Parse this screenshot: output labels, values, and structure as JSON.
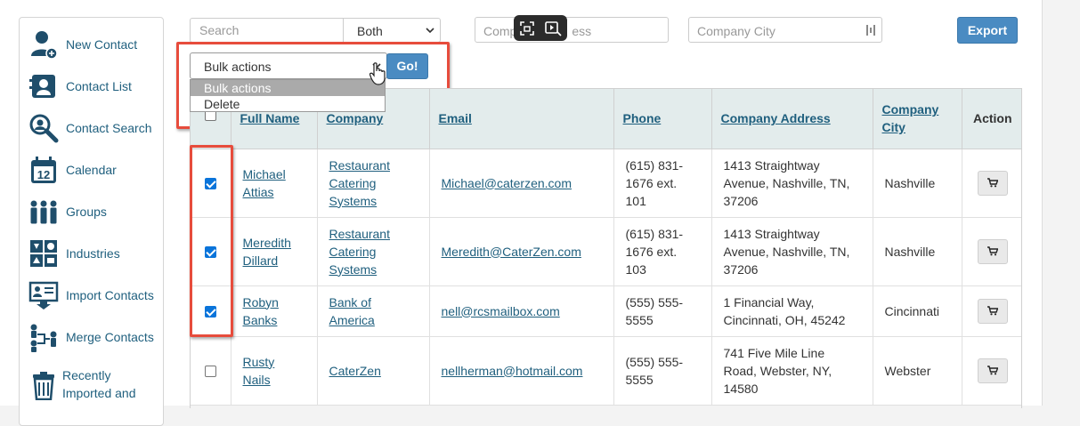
{
  "sidebar": {
    "items": [
      {
        "label": "New Contact",
        "icon": "new-contact-icon"
      },
      {
        "label": "Contact List",
        "icon": "contact-list-icon"
      },
      {
        "label": "Contact Search",
        "icon": "magnifier-icon"
      },
      {
        "label": "Calendar",
        "icon": "calendar-icon"
      },
      {
        "label": "Groups",
        "icon": "groups-icon"
      },
      {
        "label": "Industries",
        "icon": "industries-icon"
      },
      {
        "label": "Import Contacts",
        "icon": "import-contacts-icon"
      },
      {
        "label": "Merge Contacts",
        "icon": "merge-contacts-icon"
      },
      {
        "label": "Recently Imported and",
        "line1": "Recently",
        "line2": "Imported and",
        "icon": "trash-icon"
      }
    ],
    "calendar_day": "12"
  },
  "filters": {
    "search_placeholder": "Search",
    "scope_value": "Both",
    "address_placeholder_visible": "Comp",
    "address_placeholder_tail": "ess",
    "city_placeholder": "Company City",
    "export_label": "Export"
  },
  "bulk": {
    "selected_value": "Bulk actions",
    "go_label": "Go!",
    "options": [
      "Bulk actions",
      "Delete"
    ]
  },
  "table": {
    "headers": {
      "full_name": "Full Name",
      "company": "Company",
      "email": "Email",
      "phone": "Phone",
      "company_address": "Company Address",
      "company_city_1": "Company",
      "company_city_2": "City",
      "action": "Action"
    },
    "rows": [
      {
        "checked": true,
        "name1": "Michael",
        "name2": "Attias",
        "company1": "Restaurant",
        "company2": "Catering",
        "company3": "Systems",
        "email": "Michael@caterzen.com",
        "phone1": "(615) 831-",
        "phone2": "1676 ext.",
        "phone3": "101",
        "addr1": "1413 Straightway",
        "addr2": "Avenue, Nashville, TN,",
        "addr3": "37206",
        "city": "Nashville"
      },
      {
        "checked": true,
        "name1": "Meredith",
        "name2": "Dillard",
        "company1": "Restaurant",
        "company2": "Catering",
        "company3": "Systems",
        "email": "Meredith@CaterZen.com",
        "phone1": "(615) 831-",
        "phone2": "1676 ext.",
        "phone3": "103",
        "addr1": "1413 Straightway",
        "addr2": "Avenue, Nashville, TN,",
        "addr3": "37206",
        "city": "Nashville"
      },
      {
        "checked": true,
        "name1": "Robyn",
        "name2": "Banks",
        "company1": "Bank of",
        "company2": "America",
        "company3": "",
        "email": "nell@rcsmailbox.com",
        "phone1": "(555) 555-",
        "phone2": "5555",
        "phone3": "",
        "addr1": "1 Financial Way,",
        "addr2": "Cincinnati, OH, 45242",
        "addr3": "",
        "city": "Cincinnati"
      },
      {
        "checked": false,
        "name1": "Rusty",
        "name2": "Nails",
        "company1": "CaterZen",
        "company2": "",
        "company3": "",
        "email": "nellherman@hotmail.com",
        "phone1": "(555) 555-",
        "phone2": "5555",
        "phone3": "",
        "addr1": "741 Five Mile Line",
        "addr2": "Road, Webster, NY,",
        "addr3": "14580",
        "city": "Webster"
      }
    ]
  },
  "colors": {
    "accent": "#4a8bc2",
    "highlight": "#e74c3c",
    "link": "#1f5f7e",
    "header_bg": "#e3ecec"
  }
}
